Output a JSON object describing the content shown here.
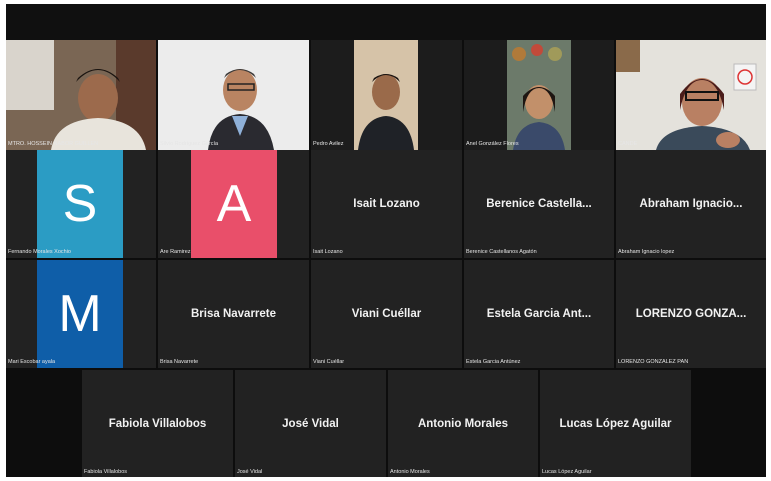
{
  "colors": {
    "background": "#0d0d0d",
    "tile": "#232323",
    "avatar_s": "#2b9cc4",
    "avatar_a": "#e94f6a",
    "avatar_m": "#0f5ea8"
  },
  "video_row": [
    {
      "name": "MTRO. HOSSEIN NABOR GUILLEN"
    },
    {
      "name": "Silvio Rodríguez García"
    },
    {
      "name": "Pedro Avilez"
    },
    {
      "name": "Anel González Flores"
    },
    {
      "name": "CANDE"
    }
  ],
  "row2": [
    {
      "avatar_letter": "S",
      "name": "Fernando Morales Xochio"
    },
    {
      "avatar_letter": "A",
      "name": "Are Ramirez"
    },
    {
      "display": "Isait Lozano",
      "name": "Isait Lozano"
    },
    {
      "display": "Berenice Castella...",
      "name": "Berenice Castellanos Agatón"
    },
    {
      "display": "Abraham Ignacio...",
      "name": "Abraham Ignacio lopez"
    }
  ],
  "row3": [
    {
      "avatar_letter": "M",
      "name": "Mari Escobar ayala"
    },
    {
      "display": "Brisa Navarrete",
      "name": "Brisa Navarrete"
    },
    {
      "display": "Viani Cuéllar",
      "name": "Viani Cuéllar"
    },
    {
      "display": "Estela Garcia Ant...",
      "name": "Estela Garcia Antúnez"
    },
    {
      "display": "LORENZO GONZA...",
      "name": "LORENZO GONZALEZ PAN"
    }
  ],
  "row4": [
    {
      "display": "Fabiola Villalobos",
      "name": "Fabiola Villalobos"
    },
    {
      "display": "José Vidal",
      "name": "José Vidal"
    },
    {
      "display": "Antonio Morales",
      "name": "Antonio Morales"
    },
    {
      "display": "Lucas López Aguilar",
      "name": "Lucas López Aguilar"
    }
  ]
}
